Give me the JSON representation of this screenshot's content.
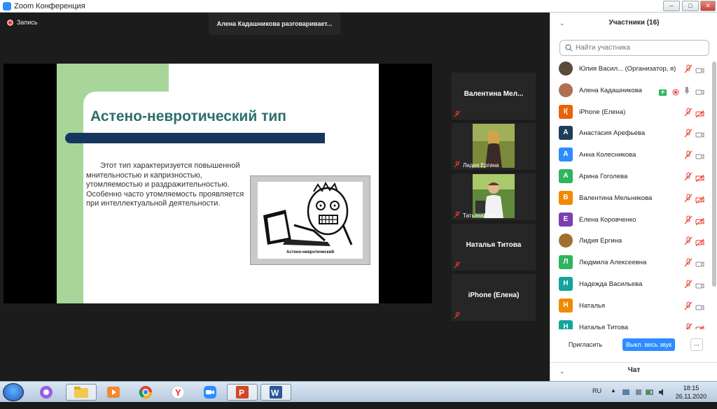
{
  "window": {
    "title": "Zoom Конференция"
  },
  "meeting": {
    "recording_label": "Запись",
    "talking_banner": "Алена Кадашникова разговаривает..."
  },
  "slide": {
    "title": "Астено-невротический тип",
    "body": "Этот тип характеризуется повышенной мнительностью и капризностью, утомляемостью и раздражительностью. Особенно часто утомляемость проявляется при интеллектуальной деятельности.",
    "picture_caption": "Астено-невротический"
  },
  "video_tiles": [
    {
      "name": "Валентина Мел...",
      "muted": true
    },
    {
      "name": "Лидия Ергина",
      "muted": true
    },
    {
      "name": "Татьяна Леб...",
      "muted": true
    },
    {
      "name": "Наталья Титова",
      "muted": true
    },
    {
      "name": "iPhone (Елена)",
      "muted": true
    }
  ],
  "participants_panel": {
    "title": "Участники (16)",
    "search_placeholder": "Найти участника",
    "invite_label": "Пригласить",
    "mute_all_label": "Выкл. весь звук",
    "more_label": "...",
    "chat_label": "Чат",
    "participants": [
      {
        "name": "Юлия Васил... (Организатор, я)",
        "initial": "",
        "color": "#5a4a3a",
        "mic": "muted",
        "cam": "on",
        "photo": true
      },
      {
        "name": "Алена Кадашникова",
        "initial": "",
        "color": "#b07050",
        "mic": "on",
        "cam": "on",
        "photo": true,
        "share": true
      },
      {
        "name": "iPhone (Елена)",
        "initial": "I(",
        "color": "#e8630a",
        "mic": "muted",
        "cam": "off"
      },
      {
        "name": "Анастасия Арефьева",
        "initial": "А",
        "color": "#1f3d5c",
        "mic": "muted",
        "cam": "on"
      },
      {
        "name": "Анна Колесникова",
        "initial": "А",
        "color": "#2d8cff",
        "mic": "muted",
        "cam": "on"
      },
      {
        "name": "Арина Гоголева",
        "initial": "А",
        "color": "#2eb55f",
        "mic": "muted",
        "cam": "off"
      },
      {
        "name": "Валентина Мельникова",
        "initial": "В",
        "color": "#f08a00",
        "mic": "muted",
        "cam": "off"
      },
      {
        "name": "Елена Коровченко",
        "initial": "Е",
        "color": "#7a3fb0",
        "mic": "muted",
        "cam": "off"
      },
      {
        "name": "Лидия Ергина",
        "initial": "",
        "color": "#a07030",
        "mic": "muted",
        "cam": "off",
        "photo": true
      },
      {
        "name": "Людмила Алексеевна",
        "initial": "Л",
        "color": "#2eb55f",
        "mic": "muted",
        "cam": "on"
      },
      {
        "name": "Надежда Васильева",
        "initial": "Н",
        "color": "#13a49a",
        "mic": "muted",
        "cam": "on"
      },
      {
        "name": "Наталья",
        "initial": "Н",
        "color": "#f08a00",
        "mic": "muted",
        "cam": "on"
      },
      {
        "name": "Наталья Титова",
        "initial": "Н",
        "color": "#13a49a",
        "mic": "muted",
        "cam": "off"
      }
    ]
  },
  "taskbar": {
    "lang": "RU",
    "time": "18:15",
    "date": "26.11.2020"
  },
  "colors": {
    "accent": "#2d8cff",
    "muted_red": "#e8362c",
    "slide_title": "#2e6e6e"
  }
}
